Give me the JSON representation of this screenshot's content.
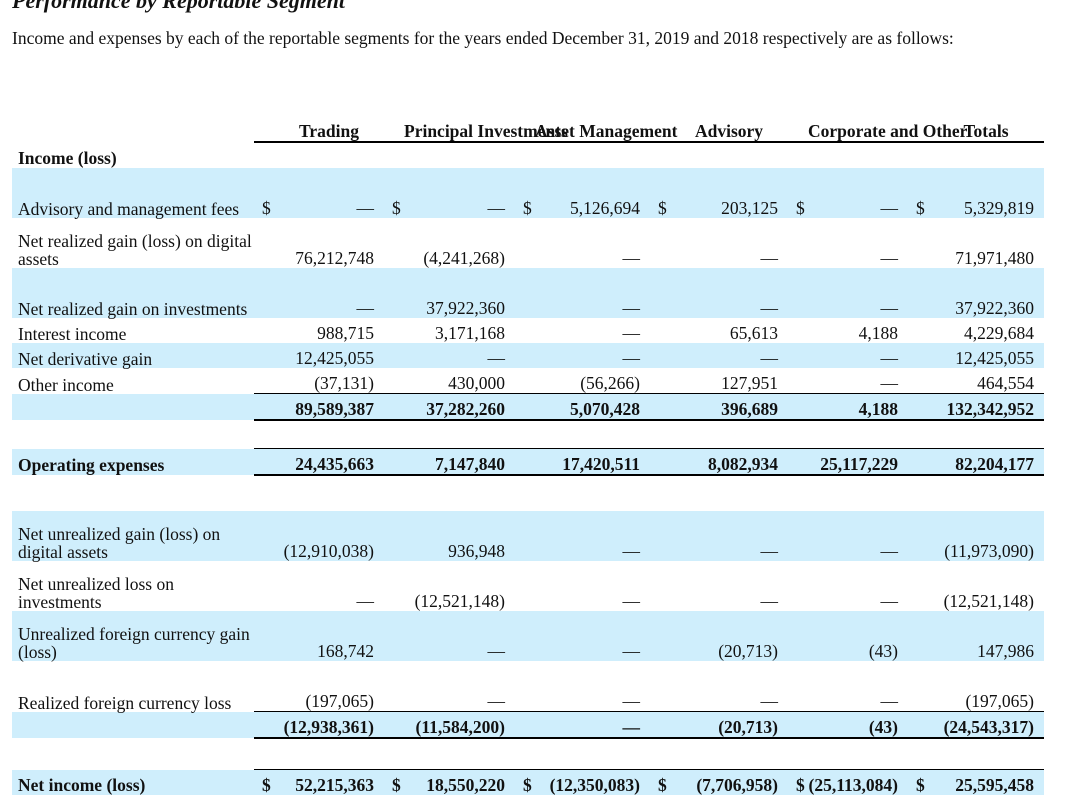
{
  "heading": "Performance by Reportable Segment",
  "intro": "Income and expenses by each of the reportable segments for the years ended December 31, 2019 and 2018 respectively are as follows:",
  "columns": [
    "Trading",
    "Principal Investments",
    "Asset Management",
    "Advisory",
    "Corporate and Other",
    "Totals"
  ],
  "sections": {
    "income": "Income (loss)",
    "opex": "Operating expenses",
    "net": "Net income (loss)"
  },
  "currency": "$",
  "dash": "—",
  "income_rows": [
    {
      "label": "Advisory and management fees",
      "values": [
        "—",
        "—",
        "5,126,694",
        "203,125",
        "—",
        "5,329,819"
      ]
    },
    {
      "label": "Net realized gain (loss) on digital assets",
      "values": [
        "76,212,748",
        "(4,241,268)",
        "—",
        "—",
        "—",
        "71,971,480"
      ]
    },
    {
      "label": "Net realized gain on investments",
      "values": [
        "—",
        "37,922,360",
        "—",
        "—",
        "—",
        "37,922,360"
      ]
    },
    {
      "label": "Interest income",
      "values": [
        "988,715",
        "3,171,168",
        "—",
        "65,613",
        "4,188",
        "4,229,684"
      ]
    },
    {
      "label": "Net derivative gain",
      "values": [
        "12,425,055",
        "—",
        "—",
        "—",
        "—",
        "12,425,055"
      ]
    },
    {
      "label": "Other income",
      "values": [
        "(37,131)",
        "430,000",
        "(56,266)",
        "127,951",
        "—",
        "464,554"
      ]
    }
  ],
  "income_total": [
    "89,589,387",
    "37,282,260",
    "5,070,428",
    "396,689",
    "4,188",
    "132,342,952"
  ],
  "opex_values": [
    "24,435,663",
    "7,147,840",
    "17,420,511",
    "8,082,934",
    "25,117,229",
    "82,204,177"
  ],
  "unrealized_rows": [
    {
      "label": "Net unrealized gain (loss) on digital assets",
      "values": [
        "(12,910,038)",
        "936,948",
        "—",
        "—",
        "—",
        "(11,973,090)"
      ]
    },
    {
      "label": "Net unrealized loss on investments",
      "values": [
        "—",
        "(12,521,148)",
        "—",
        "—",
        "—",
        "(12,521,148)"
      ]
    },
    {
      "label": "Unrealized foreign currency gain (loss)",
      "values": [
        "168,742",
        "—",
        "—",
        "(20,713)",
        "(43)",
        "147,986"
      ]
    },
    {
      "label": "Realized foreign currency loss",
      "values": [
        "(197,065)",
        "—",
        "—",
        "—",
        "—",
        "(197,065)"
      ]
    }
  ],
  "unrealized_total": [
    "(12,938,361)",
    "(11,584,200)",
    "—",
    "(20,713)",
    "(43)",
    "(24,543,317)"
  ],
  "net_values": [
    "52,215,363",
    "18,550,220",
    "(12,350,083)",
    "(7,706,958)",
    "(25,113,084)",
    "25,595,458"
  ]
}
